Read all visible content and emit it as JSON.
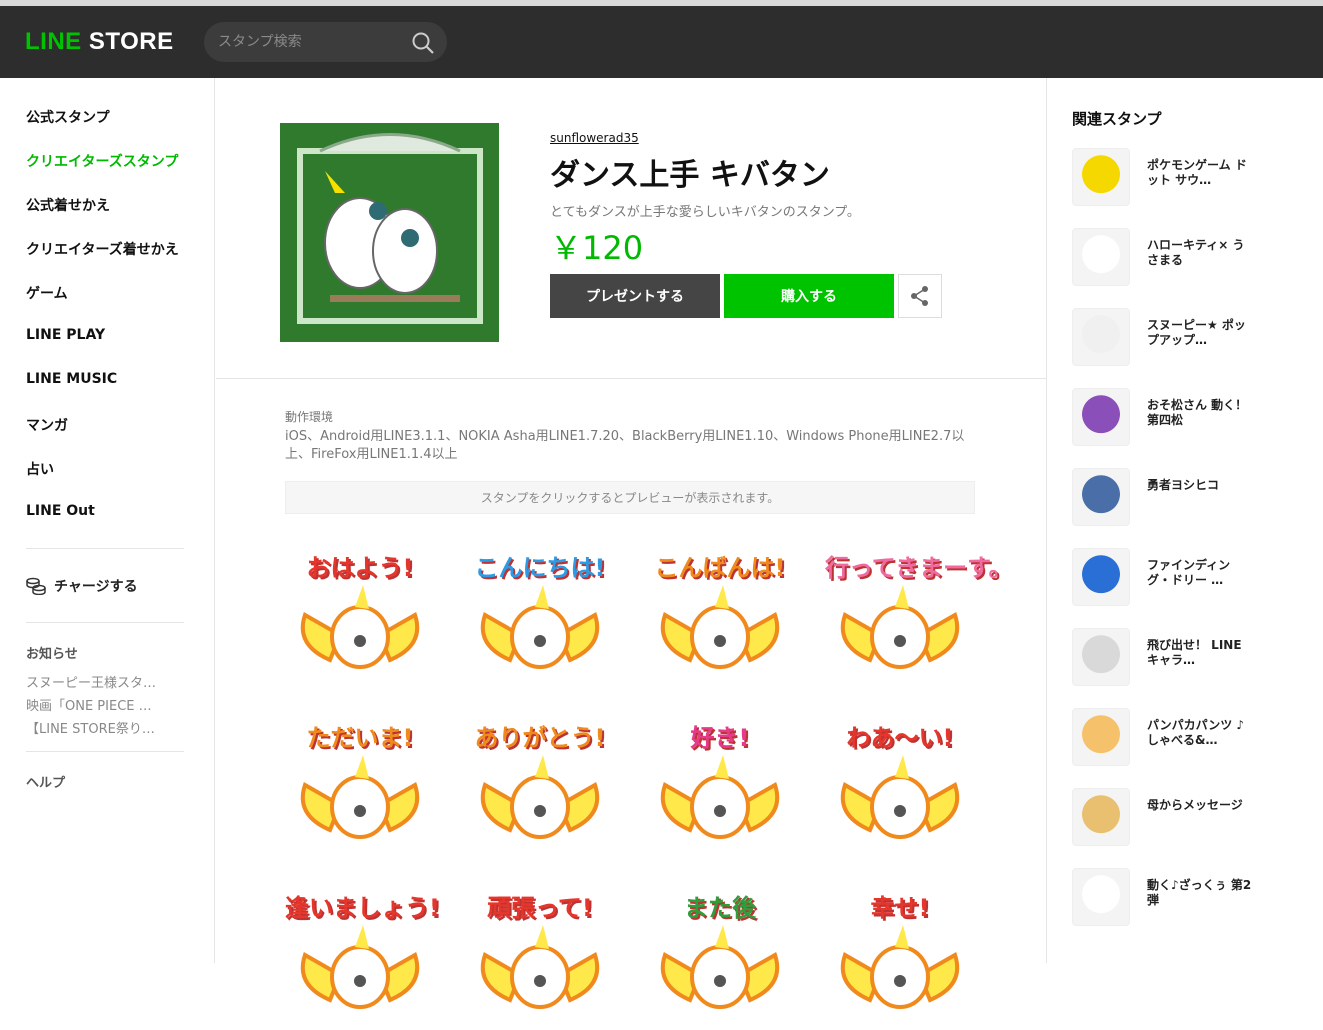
{
  "header": {
    "logo_line": "LINE",
    "logo_store": "STORE",
    "search_placeholder": "スタンプ検索"
  },
  "sidebar": {
    "items": [
      {
        "label": "公式スタンプ"
      },
      {
        "label": "クリエイターズスタンプ"
      },
      {
        "label": "公式着せかえ"
      },
      {
        "label": "クリエイターズ着せかえ"
      },
      {
        "label": "ゲーム"
      },
      {
        "label": "LINE PLAY"
      },
      {
        "label": "LINE MUSIC"
      },
      {
        "label": "マンガ"
      },
      {
        "label": "占い"
      },
      {
        "label": "LINE Out"
      }
    ],
    "charge_label": "チャージする",
    "news_title": "お知らせ",
    "news": [
      "スヌーピー王様スタ…",
      "映画「ONE PIECE …",
      "【LINE STORE祭り…"
    ],
    "help_label": "ヘルプ"
  },
  "product": {
    "author": "sunflowerad35",
    "title": "ダンス上手 キバタン",
    "description": "とてもダンスが上手な愛らしいキバタンのスタンプ。",
    "price": "￥120",
    "present_label": "プレゼントする",
    "buy_label": "購入する",
    "env_label": "動作環境",
    "env_text": "iOS、Android用LINE3.1.1、NOKIA Asha用LINE1.7.20、BlackBerry用LINE1.10、Windows Phone用LINE2.7以上、FireFox用LINE1.1.4以上",
    "hint": "スタンプをクリックするとプレビューが表示されます。"
  },
  "stickers": [
    {
      "text": "おはよう!",
      "color": "#e6352b"
    },
    {
      "text": "こんにちは!",
      "color": "#2b9be6"
    },
    {
      "text": "こんばんは!",
      "color": "#f08a1c"
    },
    {
      "text": "行ってきまーす。",
      "color": "#f06aa0"
    },
    {
      "text": "ただいま!",
      "color": "#f08a1c"
    },
    {
      "text": "ありがとう!",
      "color": "#f08a1c"
    },
    {
      "text": "好き!",
      "color": "#e63a8a"
    },
    {
      "text": "わあ～い!",
      "color": "#e6352b"
    },
    {
      "text": "逢いましょう!",
      "color": "#e6352b"
    },
    {
      "text": "頑張って!",
      "color": "#e6352b"
    },
    {
      "text": "また後",
      "color": "#2e9e3a"
    },
    {
      "text": "幸せ!",
      "color": "#e6352b"
    }
  ],
  "related": {
    "heading": "関連スタンプ",
    "items": [
      {
        "name": "ポケモンゲーム ドット サウ…",
        "color": "#f5d800"
      },
      {
        "name": "ハローキティ× うさまる",
        "color": "#ffffff"
      },
      {
        "name": "スヌーピー★ ポップアップ…",
        "color": "#f0f0f0"
      },
      {
        "name": "おそ松さん 動く！第四松",
        "color": "#8a4fb8"
      },
      {
        "name": "勇者ヨシヒコ",
        "color": "#4a6fa8"
      },
      {
        "name": "ファインディング・ドリー …",
        "color": "#2a6fd6"
      },
      {
        "name": "飛び出せ！ LINEキャラ…",
        "color": "#d9d9d9"
      },
      {
        "name": "パンパカパンツ ♪しゃべる&…",
        "color": "#f5c26b"
      },
      {
        "name": "母からメッセージ",
        "color": "#e8c070"
      },
      {
        "name": "動く♪ざっくぅ 第2弾",
        "color": "#ffffff"
      }
    ]
  }
}
